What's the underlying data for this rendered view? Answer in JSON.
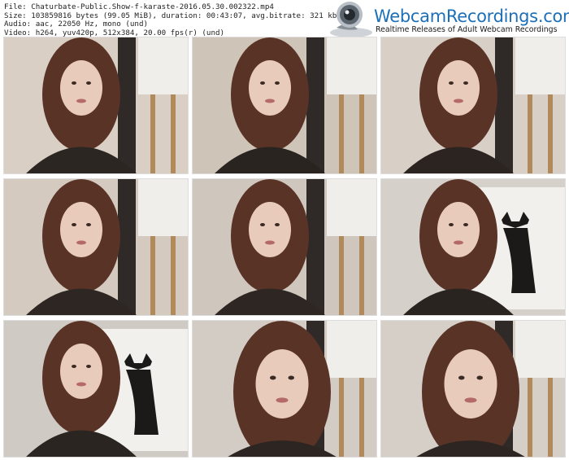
{
  "file_info": {
    "file": "File: Chaturbate-Public.Show-f-karaste-2016.05.30.002322.mp4",
    "size": "Size: 103859816 bytes (99.05 MiB), duration: 00:43:07, avg.bitrate: 321 kb/s",
    "audio": "Audio: aac, 22050 Hz, mono (und)",
    "video": "Video: h264, yuv420p, 512x384, 20.00 fps(r) (und)"
  },
  "logo": {
    "name": "WebcamRecordings.com",
    "tagline": "Realtime Releases of Adult Webcam Recordings",
    "icon": "webcam-icon"
  },
  "thumbnails": [
    {
      "scene": "woman-hand-near-face",
      "wall": "#d9cfc4",
      "dark": "#2b2622"
    },
    {
      "scene": "woman-talking",
      "wall": "#cfc4b8",
      "dark": "#2a2420"
    },
    {
      "scene": "woman-hand-on-head",
      "wall": "#d8cfc6",
      "dark": "#2b2420"
    },
    {
      "scene": "woman-arms-crossed",
      "wall": "#d4cac0",
      "dark": "#2d2622"
    },
    {
      "scene": "woman-talking",
      "wall": "#cfc6bd",
      "dark": "#2d2622"
    },
    {
      "scene": "woman-with-deer-painting",
      "wall": "#d6d0ca",
      "dark": "#2a2420"
    },
    {
      "scene": "woman-with-deer-painting",
      "wall": "#cfcac4",
      "dark": "#2b2522"
    },
    {
      "scene": "woman-closeup",
      "wall": "#d3ccc5",
      "dark": "#2c2521"
    },
    {
      "scene": "woman-closeup",
      "wall": "#d6cfc8",
      "dark": "#2c2521"
    }
  ]
}
